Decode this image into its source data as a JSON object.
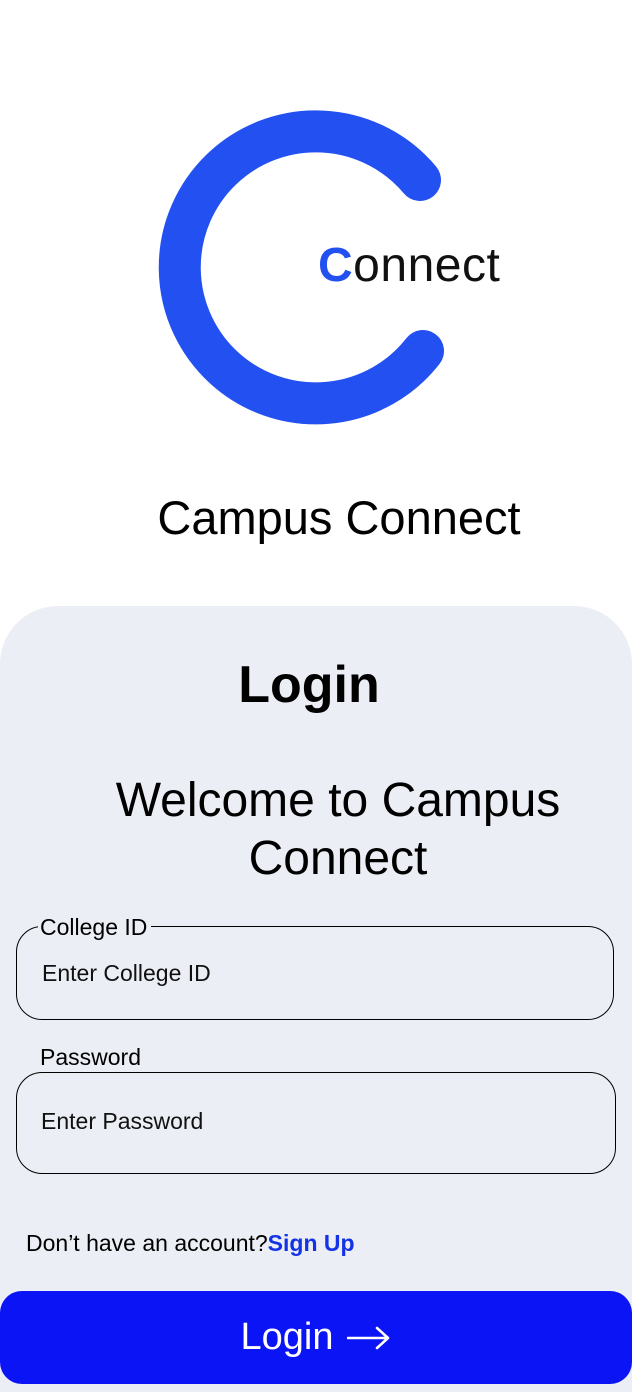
{
  "logo": {
    "first_letter": "C",
    "rest": "onnect",
    "accent_color": "#2350f0"
  },
  "app": {
    "title": "Campus Connect"
  },
  "login_card": {
    "title": "Login",
    "welcome": "Welcome to Campus Connect",
    "college_id": {
      "label": "College ID",
      "placeholder": "Enter College ID",
      "value": ""
    },
    "password": {
      "label": "Password",
      "placeholder": "Enter Password",
      "value": ""
    },
    "signup_prompt": "Don’t have an account?",
    "signup_link": "Sign Up",
    "login_button": "Login",
    "login_button_icon": "arrow-right-icon",
    "background_color": "#ebeef5",
    "button_color": "#0a14f5",
    "link_color": "#1432e6"
  }
}
